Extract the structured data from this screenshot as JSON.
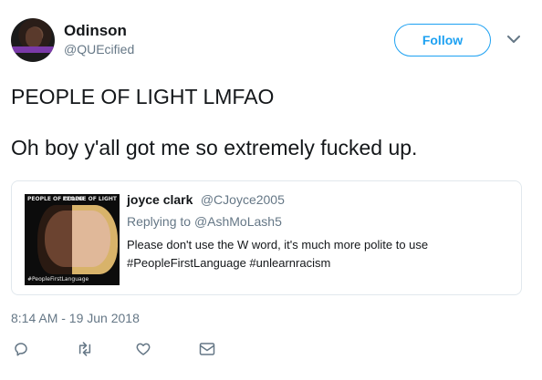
{
  "author": {
    "display_name": "Odinson",
    "handle": "@QUEcified"
  },
  "follow_label": "Follow",
  "tweet": {
    "line1": "PEOPLE OF LIGHT LMFAO",
    "line2": "Oh boy y'all got me so extremely fucked up."
  },
  "quoted": {
    "display_name": "joyce clark",
    "handle": "@CJoyce2005",
    "replying_prefix": "Replying to ",
    "replying_handle": "@AshMoLash5",
    "text_line1": "Please don't use the W word, it's much more polite to use",
    "text_line2": "#PeopleFirstLanguage #unlearnracism",
    "image_label_left": "PEOPLE OF COLOR",
    "image_label_right": "PEOPLE OF LIGHT",
    "image_footer": "#PeopleFirstLanguage"
  },
  "timestamp": "8:14 AM - 19 Jun 2018",
  "colors": {
    "accent": "#1da1f2",
    "muted": "#657786",
    "text": "#14171a",
    "border": "#e1e8ed"
  },
  "icons": [
    "reply-icon",
    "retweet-icon",
    "like-icon",
    "message-icon",
    "chevron-down-icon"
  ]
}
